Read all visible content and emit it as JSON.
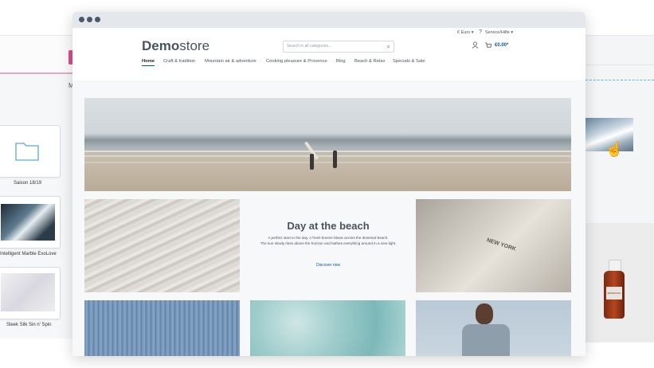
{
  "background_left": {
    "menu_letter": "M",
    "cards": [
      {
        "label": "Saison 18/19"
      },
      {
        "label": "Intelligent Marble ExoLove"
      },
      {
        "label": "Sleek Silk Sin n' Spin"
      }
    ]
  },
  "background_right": {
    "bottle_label": "PATCHOULI"
  },
  "store": {
    "logo_bold": "Demo",
    "logo_light": "store",
    "currency": "€ Euro ▾",
    "service": "Service/Hilfe ▾",
    "search_placeholder": "Search in all categories...",
    "cart_total": "€0.00*",
    "nav": [
      "Home",
      "Craft & tradition",
      "Mountain air & adventure",
      "Cooking pleasure & Provence",
      "Blog",
      "Beach & Relax",
      "Specials & Sale"
    ],
    "teaser": {
      "title": "Day at the beach",
      "text_line1": "A perfect start to the day. A fresh breeze blows across the deserted beach.",
      "text_line2": "The sun slowly rises above the horizon and bathes everything around in a new light.",
      "link": "Discover now"
    },
    "bag_print": "NEW YORK"
  },
  "colors": {
    "accent": "#0b539b",
    "text": "#4a545e",
    "titlebar": "#e4e8ec",
    "window_dots": "#495969"
  }
}
